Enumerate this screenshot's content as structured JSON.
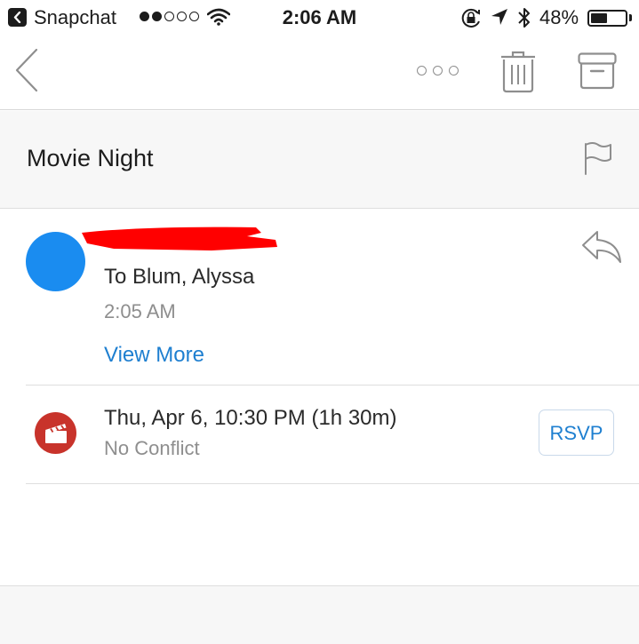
{
  "status_bar": {
    "back_app": "Snapchat",
    "signal_dots_filled": 2,
    "signal_dots_total": 5,
    "time": "2:06 AM",
    "battery_text": "48%",
    "battery_level": 0.48
  },
  "toolbar": {
    "icons": [
      "back-chevron-icon",
      "more-icon",
      "trash-icon",
      "archive-icon"
    ]
  },
  "message": {
    "subject": "Movie Night",
    "to": "To Blum, Alyssa",
    "time": "2:05 AM",
    "view_more": "View More"
  },
  "event": {
    "datetime": "Thu, Apr 6, 10:30 PM (1h 30m)",
    "status": "No Conflict",
    "rsvp_label": "RSVP"
  },
  "colors": {
    "accent": "#1e7fd0",
    "avatar": "#1a8cf0",
    "event_icon": "#c8332b",
    "redaction": "#ff0000"
  }
}
